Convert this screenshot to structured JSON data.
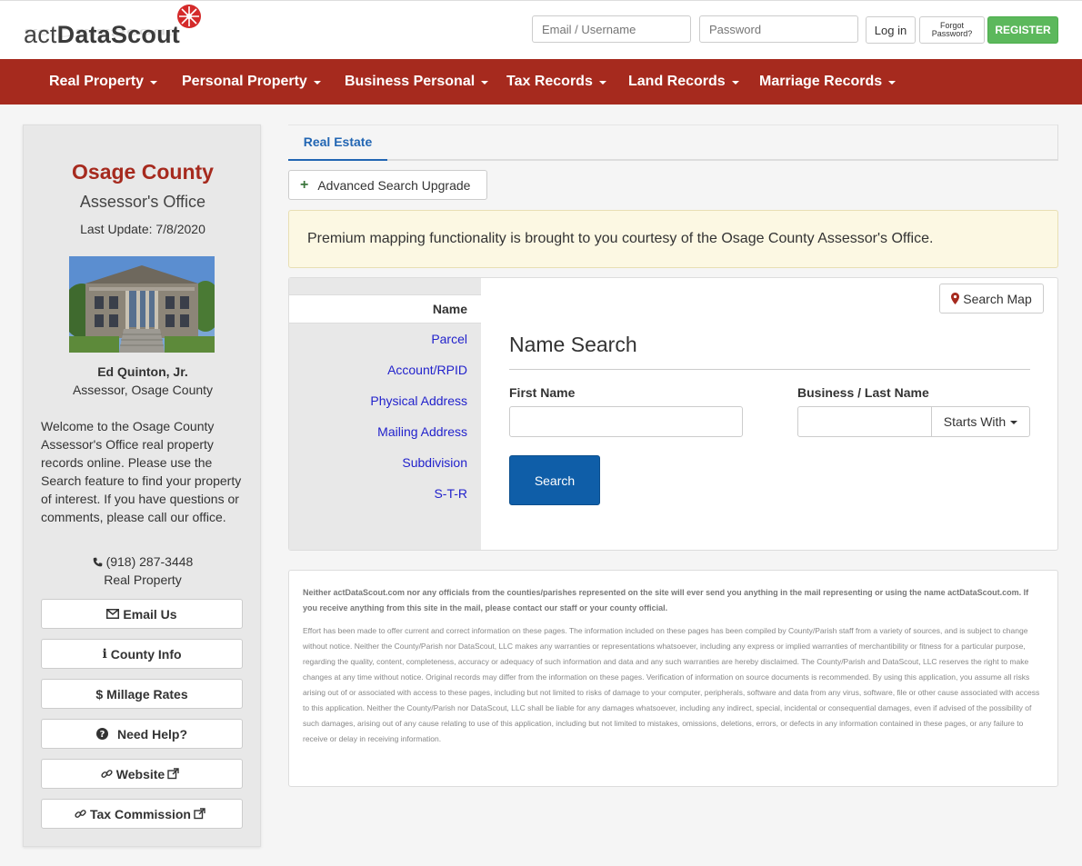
{
  "header": {
    "logo_prefix": "act",
    "logo_bold": "DataScout",
    "logo_rest": "",
    "email_placeholder": "Email / Username",
    "password_placeholder": "Password",
    "login_label": "Log in",
    "forgot_line1": "Forgot",
    "forgot_line2": "Password?",
    "register_label": "REGISTER"
  },
  "nav": {
    "items": [
      {
        "label": "Real Property"
      },
      {
        "label": "Personal Property"
      },
      {
        "label": "Business Personal"
      },
      {
        "label": "Tax Records"
      },
      {
        "label": "Land Records"
      },
      {
        "label": "Marriage Records"
      }
    ]
  },
  "sidebar": {
    "county": "Osage County",
    "office": "Assessor's Office",
    "last_update": "Last Update: 7/8/2020",
    "assessor_name": "Ed Quinton, Jr.",
    "assessor_title": "Assessor, Osage County",
    "welcome": "Welcome to the Osage County Assessor's Office real property records online. Please use the Search feature to find your property of interest. If you have questions or comments, please call our office.",
    "phone": "(918) 287-3448",
    "phone_label": "Real Property",
    "buttons": [
      {
        "label": "Email Us",
        "icon": "envelope-icon"
      },
      {
        "label": "County Info",
        "icon": "info-icon"
      },
      {
        "label": "Millage Rates",
        "icon": "dollar-icon"
      },
      {
        "label": "Need Help?",
        "icon": "question-icon"
      },
      {
        "label": "Website",
        "icon": "link-icon"
      },
      {
        "label": "Tax Commission",
        "icon": "link-icon"
      }
    ]
  },
  "main": {
    "tab_label": "Real Estate",
    "advanced_label": "Advanced Search Upgrade",
    "alert_text": "Premium mapping functionality is brought to you courtesy of the Osage County Assessor's Office.",
    "search_tabs": [
      {
        "label": "Name",
        "active": true
      },
      {
        "label": "Parcel"
      },
      {
        "label": "Account/RPID"
      },
      {
        "label": "Physical Address"
      },
      {
        "label": "Mailing Address"
      },
      {
        "label": "Subdivision"
      },
      {
        "label": "S-T-R"
      }
    ],
    "search_map_label": "Search Map",
    "form_title": "Name Search",
    "first_name_label": "First Name",
    "last_name_label": "Business / Last Name",
    "first_name_value": "",
    "last_name_value": "",
    "starts_with_label": "Starts With",
    "search_button": "Search"
  },
  "disclaimer": {
    "bold": "Neither actDataScout.com nor any officials from the counties/parishes represented on the site will ever send you anything in the mail representing or using the name actDataScout.com. If you receive anything from this site in the mail, please contact our staff or your county official.",
    "body": "Effort has been made to offer current and correct information on these pages. The information included on these pages has been compiled by County/Parish staff from a variety of sources, and is subject to change without notice. Neither the County/Parish nor DataScout, LLC makes any warranties or representations whatsoever, including any express or implied warranties of merchantibility or fitness for a particular purpose, regarding the quality, content, completeness, accuracy or adequacy of such information and data and any such warranties are hereby disclaimed. The County/Parish and DataScout, LLC reserves the right to make changes at any time without notice. Original records may differ from the information on these pages. Verification of information on source documents is recommended. By using this application, you assume all risks arising out of or associated with access to these pages, including but not limited to risks of damage to your computer, peripherals, software and data from any virus, software, file or other cause associated with access to this application. Neither the County/Parish nor DataScout, LLC shall be liable for any damages whatsoever, including any indirect, special, incidental or consequential damages, even if advised of the possibility of such damages, arising out of any cause relating to use of this application, including but not limited to mistakes, omissions, deletions, errors, or defects in any information contained in these pages, or any failure to receive or delay in receiving information."
  },
  "colors": {
    "brand_red": "#a62a1e",
    "link_blue": "#2266b3",
    "register_green": "#5cb85c",
    "search_blue": "#0f5ea8"
  }
}
